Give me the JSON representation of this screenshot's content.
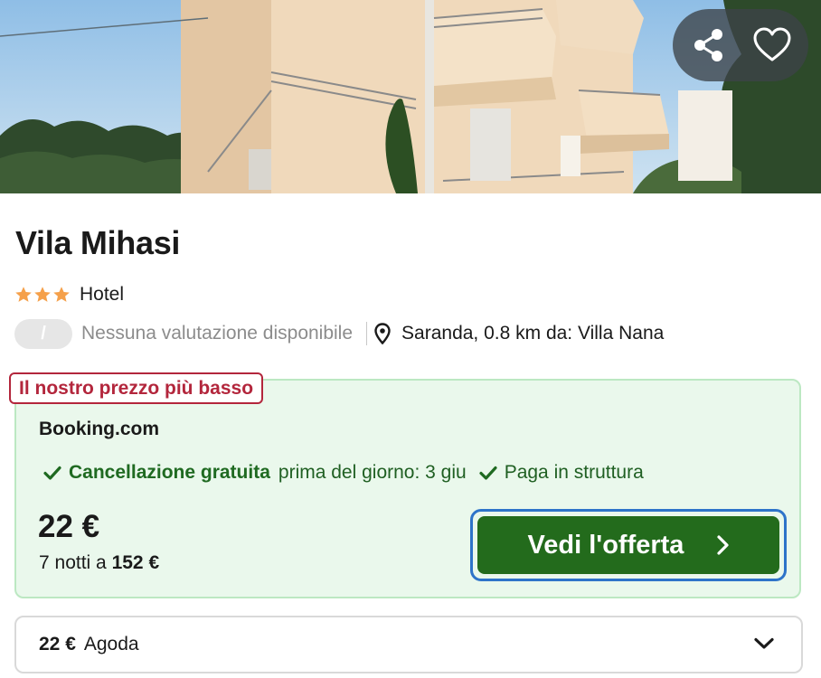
{
  "hotel": {
    "name": "Vila Mihasi",
    "star_count": 3,
    "type": "Hotel",
    "rating_badge": "/",
    "rating_text": "Nessuna valutazione disponibile",
    "location": "Saranda, 0.8 km da: Villa Nana"
  },
  "hero": {
    "share_icon": "share-icon",
    "favorite_icon": "heart-icon"
  },
  "best_deal": {
    "tag": "Il nostro prezzo più basso",
    "provider": "Booking.com",
    "feature1_strong": "Cancellazione gratuita",
    "feature1_detail": "prima del giorno: 3 giu",
    "feature2": "Paga in struttura",
    "price": "22 €",
    "nights_prefix": "7 notti a",
    "nights_total": "152 €",
    "cta_label": "Vedi l'offerta"
  },
  "alt_offer": {
    "price": "22 €",
    "provider": "Agoda"
  },
  "colors": {
    "deal_background": "#eaf8ec",
    "deal_border": "#bce8c2",
    "tag_red": "#b3263c",
    "cta_green": "#236b1c",
    "cta_focus_ring": "#2e74c9",
    "feature_green": "#1f6a21",
    "star_orange": "#f5a04a"
  }
}
